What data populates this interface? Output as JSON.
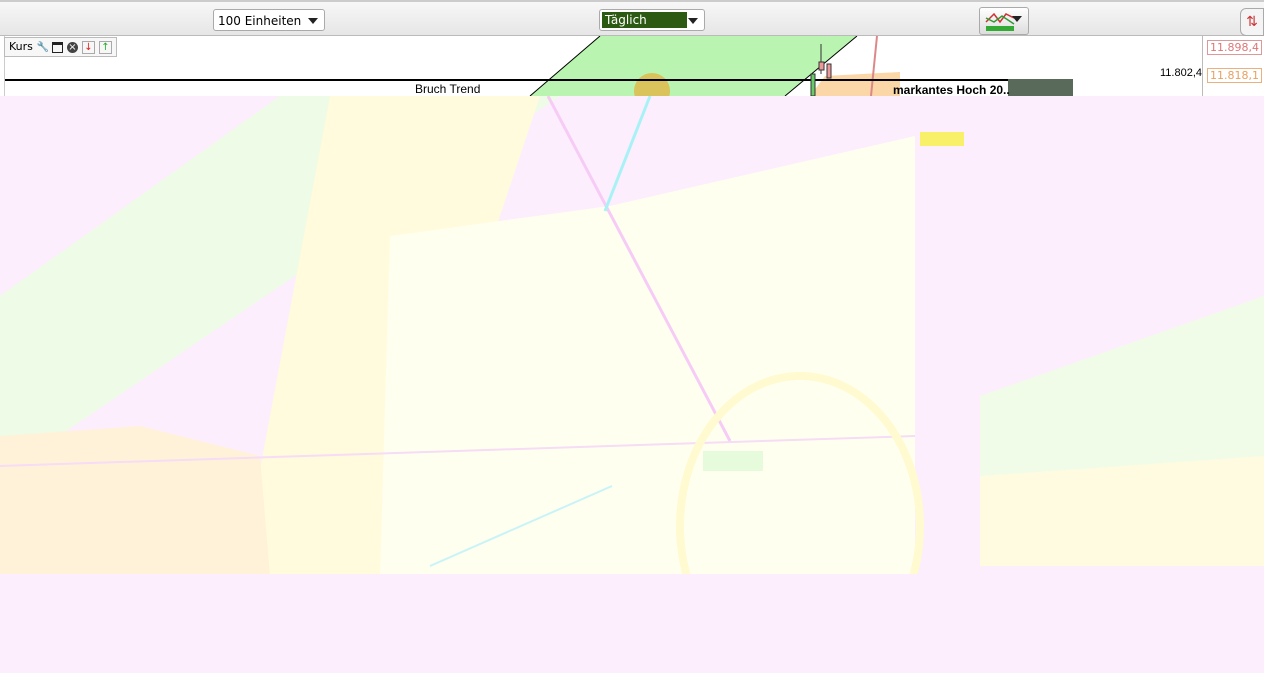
{
  "toolbar": {
    "units": "100 Einheiten",
    "period": "Täglich",
    "indicator_icon": "indicator-chart-icon",
    "refresh_icon": "refresh-icon"
  },
  "chart": {
    "panel_label": "Kurs",
    "annotation_trend": "Bruch Trend",
    "annotation_high": "markantes Hoch 20..",
    "price_labels": {
      "top": "11.898,4",
      "current": "11.802,4",
      "mid": "11.818,1"
    }
  },
  "colors": {
    "period_bg": "#2d5a12",
    "green_zone": "#b9f5b0",
    "orange_zone": "#fbd6a6",
    "wash": "#fdeefd"
  }
}
